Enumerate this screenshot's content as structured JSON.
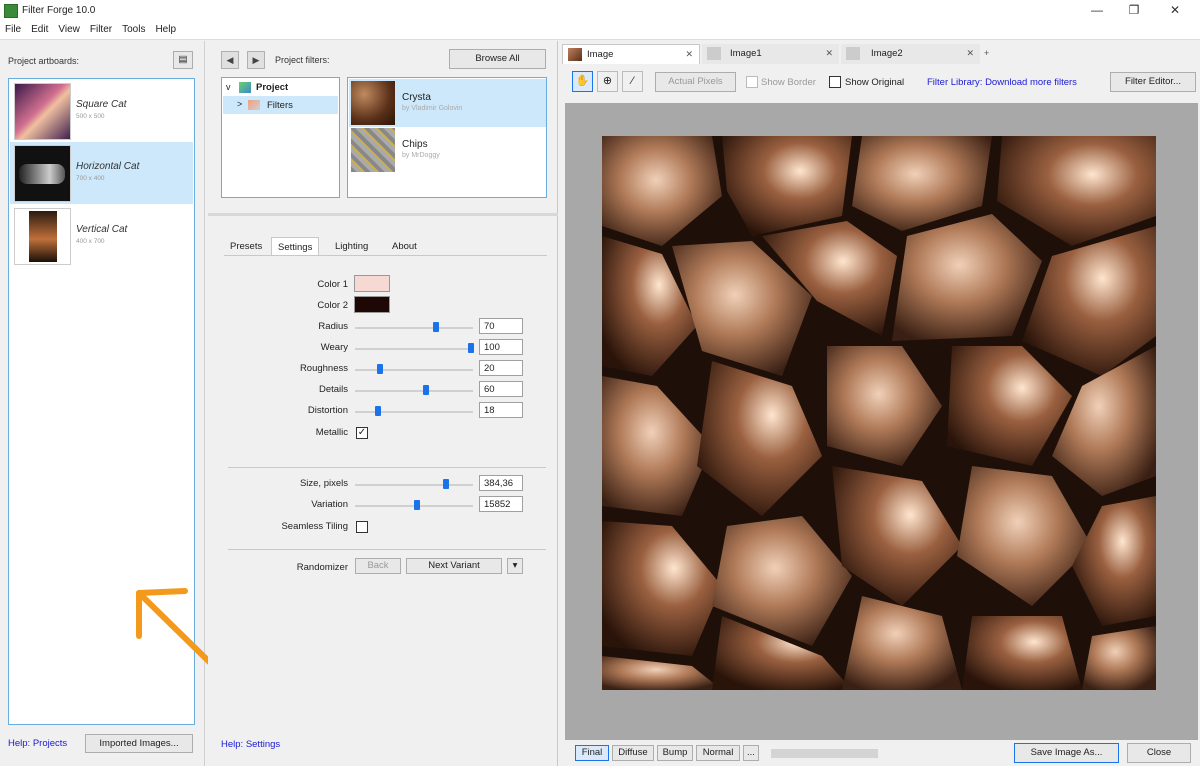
{
  "window": {
    "title": "Filter Forge 10.0",
    "min_glyph": "—",
    "max_glyph": "❐",
    "close_glyph": "✕"
  },
  "menu": [
    "File",
    "Edit",
    "View",
    "Filter",
    "Tools",
    "Help"
  ],
  "left": {
    "header": "Project artboards:",
    "artboards": [
      {
        "name": "Square Cat",
        "size": "500 x 500"
      },
      {
        "name": "Horizontal Cat",
        "size": "700 x 400"
      },
      {
        "name": "Vertical Cat",
        "size": "400 x 700"
      }
    ],
    "help_link": "Help: Projects",
    "imported_button": "Imported Images..."
  },
  "middle": {
    "header": "Project filters:",
    "browse_all": "Browse All",
    "tree": {
      "root": "Project",
      "child": "Filters"
    },
    "filters": [
      {
        "name": "Crysta",
        "author": "by Vladimir Golovin"
      },
      {
        "name": "Chips",
        "author": "by MrDoggy"
      }
    ],
    "tabs": [
      "Presets",
      "Settings",
      "Lighting",
      "About"
    ],
    "params": {
      "color1": "Color 1",
      "color2": "Color 2",
      "radius": {
        "label": "Radius",
        "value": "70"
      },
      "weary": {
        "label": "Weary",
        "value": "100"
      },
      "roughness": {
        "label": "Roughness",
        "value": "20"
      },
      "details": {
        "label": "Details",
        "value": "60"
      },
      "distortion": {
        "label": "Distortion",
        "value": "18"
      },
      "metallic": "Metallic",
      "size": {
        "label": "Size, pixels",
        "value": "384,36"
      },
      "variation": {
        "label": "Variation",
        "value": "15852"
      },
      "seamless": "Seamless Tiling"
    },
    "randomizer": {
      "label": "Randomizer",
      "back": "Back",
      "next": "Next Variant"
    },
    "help_link": "Help: Settings"
  },
  "right": {
    "tabs": [
      "Image",
      "Image1",
      "Image2"
    ],
    "actual_pixels": "Actual Pixels",
    "show_border": "Show Border",
    "show_original": "Show Original",
    "library_link": "Filter Library: Download more filters",
    "filter_editor": "Filter Editor...",
    "modes": [
      "Final",
      "Diffuse",
      "Bump",
      "Normal",
      "..."
    ],
    "save_button": "Save Image As...",
    "close_button": "Close"
  },
  "colors": {
    "color1": "#f7d9d3",
    "color2": "#1e0806",
    "accent": "#1a73e8",
    "arrow": "#f39a1c"
  }
}
